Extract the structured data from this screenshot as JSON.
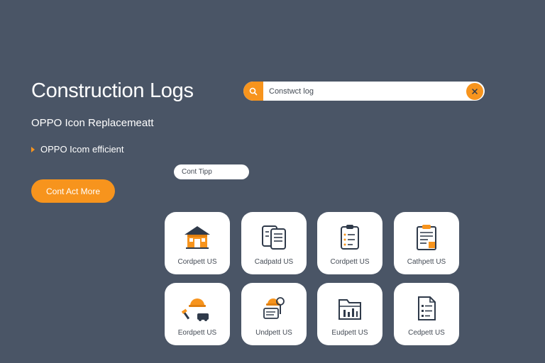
{
  "header": {
    "title": "Construction Logs",
    "subtitle": "OPPO Icon Replacemeatt",
    "bullet": "OPPO Icom efficient"
  },
  "search": {
    "value": "Constwct log",
    "icon": "search-icon",
    "clear_icon": "close-icon"
  },
  "tip": {
    "label": "Cont Tipp"
  },
  "cta": {
    "label": "Cont Act More"
  },
  "colors": {
    "accent": "#f7941d",
    "background": "#4a5566",
    "card": "#ffffff",
    "ink": "#2f3a4a"
  },
  "cards": [
    {
      "label": "Cordpett US",
      "icon": "house-icon"
    },
    {
      "label": "Cadpatd US",
      "icon": "documents-icon"
    },
    {
      "label": "Cordpett US",
      "icon": "clipboard-icon"
    },
    {
      "label": "Cathpett US",
      "icon": "report-icon"
    },
    {
      "label": "Eordpett US",
      "icon": "worker-tools-icon"
    },
    {
      "label": "Undpett US",
      "icon": "builder-search-icon"
    },
    {
      "label": "Eudpett US",
      "icon": "folder-chart-icon"
    },
    {
      "label": "Cedpett US",
      "icon": "file-list-icon"
    }
  ]
}
